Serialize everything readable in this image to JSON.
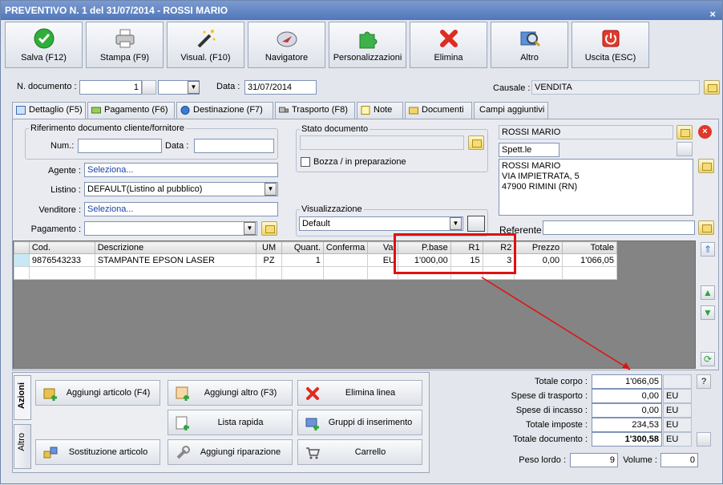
{
  "window": {
    "title": "PREVENTIVO N. 1 del 31/07/2014 - ROSSI MARIO",
    "close": "×"
  },
  "toolbar": [
    {
      "label": "Salva (F12)",
      "icon": "check-icon"
    },
    {
      "label": "Stampa (F9)",
      "icon": "printer-icon"
    },
    {
      "label": "Visual. (F10)",
      "icon": "magic-wand-icon"
    },
    {
      "label": "Navigatore",
      "icon": "compass-icon"
    },
    {
      "label": "Personalizzazioni",
      "icon": "puzzle-icon"
    },
    {
      "label": "Elimina",
      "icon": "delete-x-icon"
    },
    {
      "label": "Altro",
      "icon": "magnifier-icon"
    },
    {
      "label": "Uscita (ESC)",
      "icon": "power-icon"
    }
  ],
  "header": {
    "ndoc_label": "N. documento :",
    "ndoc_value": "1",
    "data_label": "Data :",
    "data_value": "31/07/2014",
    "causale_label": "Causale :",
    "causale_value": "VENDITA"
  },
  "tabs": [
    "Dettaglio (F5)",
    "Pagamento (F6)",
    "Destinazione (F7)",
    "Trasporto (F8)",
    "Note",
    "Documenti",
    "Campi aggiuntivi"
  ],
  "riferimento": {
    "legend": "Riferimento documento cliente/fornitore",
    "num_label": "Num.:",
    "data_label": "Data :"
  },
  "stato": {
    "legend": "Stato documento",
    "bozza": "Bozza / in preparazione"
  },
  "visualizzazione": {
    "legend": "Visualizzazione",
    "value": "Default"
  },
  "fields": {
    "agente_label": "Agente :",
    "agente_value": "Seleziona...",
    "listino_label": "Listino :",
    "listino_value": "DEFAULT(Listino al pubblico)",
    "venditore_label": "Venditore :",
    "venditore_value": "Seleziona...",
    "pagamento_label": "Pagamento :"
  },
  "cliente": {
    "name": "ROSSI MARIO",
    "title": "Spett.le",
    "address": [
      "ROSSI MARIO",
      "VIA IMPIETRATA, 5",
      "47900 RIMINI (RN)"
    ],
    "referente_label": "Referente"
  },
  "grid": {
    "columns": [
      "Cod.",
      "Descrizione",
      "UM",
      "Quant.",
      "Conferma",
      "Val",
      "P.base",
      "R1",
      "R2",
      "Prezzo",
      "Totale"
    ],
    "rows": [
      [
        "9876543233",
        "STAMPANTE EPSON LASER",
        "PZ",
        "1",
        "",
        "EU",
        "1'000,00",
        "15",
        "3",
        "0,00",
        "1'066,05"
      ]
    ]
  },
  "actions": {
    "tab_azioni": "Azioni",
    "tab_altro": "Altro",
    "buttons": [
      "Aggiungi articolo (F4)",
      "Aggiungi altro (F3)",
      "Elimina linea",
      "Lista rapida",
      "Gruppi di inserimento",
      "Sostituzione articolo",
      "Aggiungi riparazione",
      "Carrello"
    ]
  },
  "totals": {
    "corpo_label": "Totale corpo :",
    "corpo_value": "1'066,05",
    "help": "?",
    "trasporto_label": "Spese di trasporto :",
    "trasporto_value": "0,00",
    "trasporto_unit": "EU",
    "incasso_label": "Spese di incasso :",
    "incasso_value": "0,00",
    "incasso_unit": "EU",
    "imposte_label": "Totale imposte :",
    "imposte_value": "234,53",
    "imposte_unit": "EU",
    "documento_label": "Totale documento :",
    "documento_value": "1'300,58",
    "documento_unit": "EU",
    "peso_label": "Peso lordo :",
    "peso_value": "9",
    "volume_label": "Volume :",
    "volume_value": "0"
  }
}
